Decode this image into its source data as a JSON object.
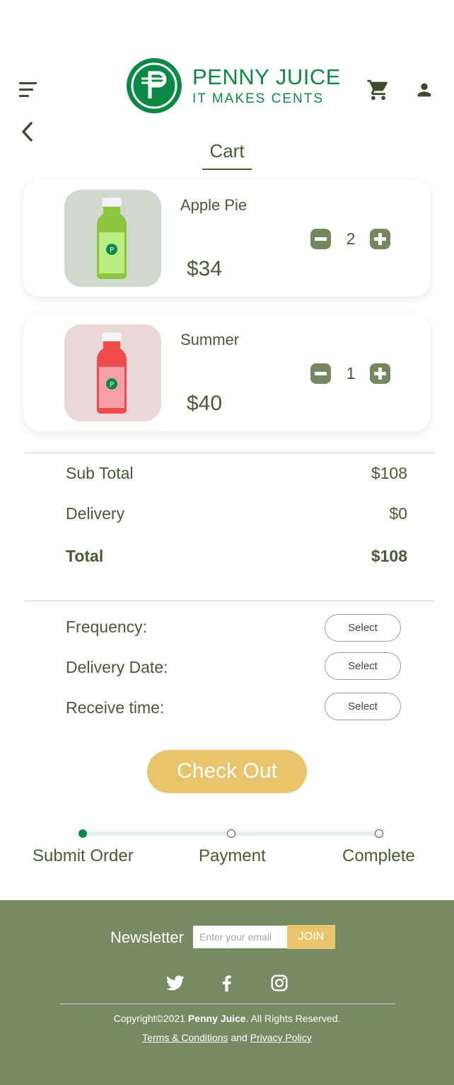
{
  "brand": {
    "name": "PENNY JUICE",
    "tagline": "IT MAKES CENTS",
    "color": "#0c8a45"
  },
  "page": {
    "title": "Cart"
  },
  "cart": {
    "items": [
      {
        "name": "Apple Pie",
        "price": "$34",
        "quantity": "2",
        "thumb_bg": "#d0d9cc",
        "bottle_color": "#8cc63f"
      },
      {
        "name": "Summer",
        "price": "$40",
        "quantity": "1",
        "thumb_bg": "#ead7d8",
        "bottle_color": "#f04b4b"
      }
    ]
  },
  "summary": {
    "subtotal_label": "Sub Total",
    "subtotal_value": "$108",
    "delivery_label": "Delivery",
    "delivery_value": "$0",
    "total_label": "Total",
    "total_value": "$108"
  },
  "options": [
    {
      "label": "Frequency:",
      "button": "Select"
    },
    {
      "label": "Delivery Date:",
      "button": "Select"
    },
    {
      "label": "Receive time:",
      "button": "Select"
    }
  ],
  "checkout": {
    "label": "Check Out",
    "color": "#e8c56c"
  },
  "progress": {
    "current_step": 1,
    "steps": [
      "Submit Order",
      "Payment",
      "Complete"
    ]
  },
  "footer": {
    "newsletter_label": "Newsletter",
    "email_placeholder": "Enter your email",
    "join_label": "JOIN",
    "social": [
      "twitter-icon",
      "facebook-icon",
      "instagram-icon"
    ],
    "copyright_prefix": "Copyright",
    "copyright_year": "2021",
    "copyright_brand": "Penny Juice",
    "copyright_suffix": ". All Rights Reserved.",
    "terms_label": "Terms & Conditions",
    "and_label": "and",
    "privacy_label": "Privacy Policy",
    "background": "#788a63"
  }
}
